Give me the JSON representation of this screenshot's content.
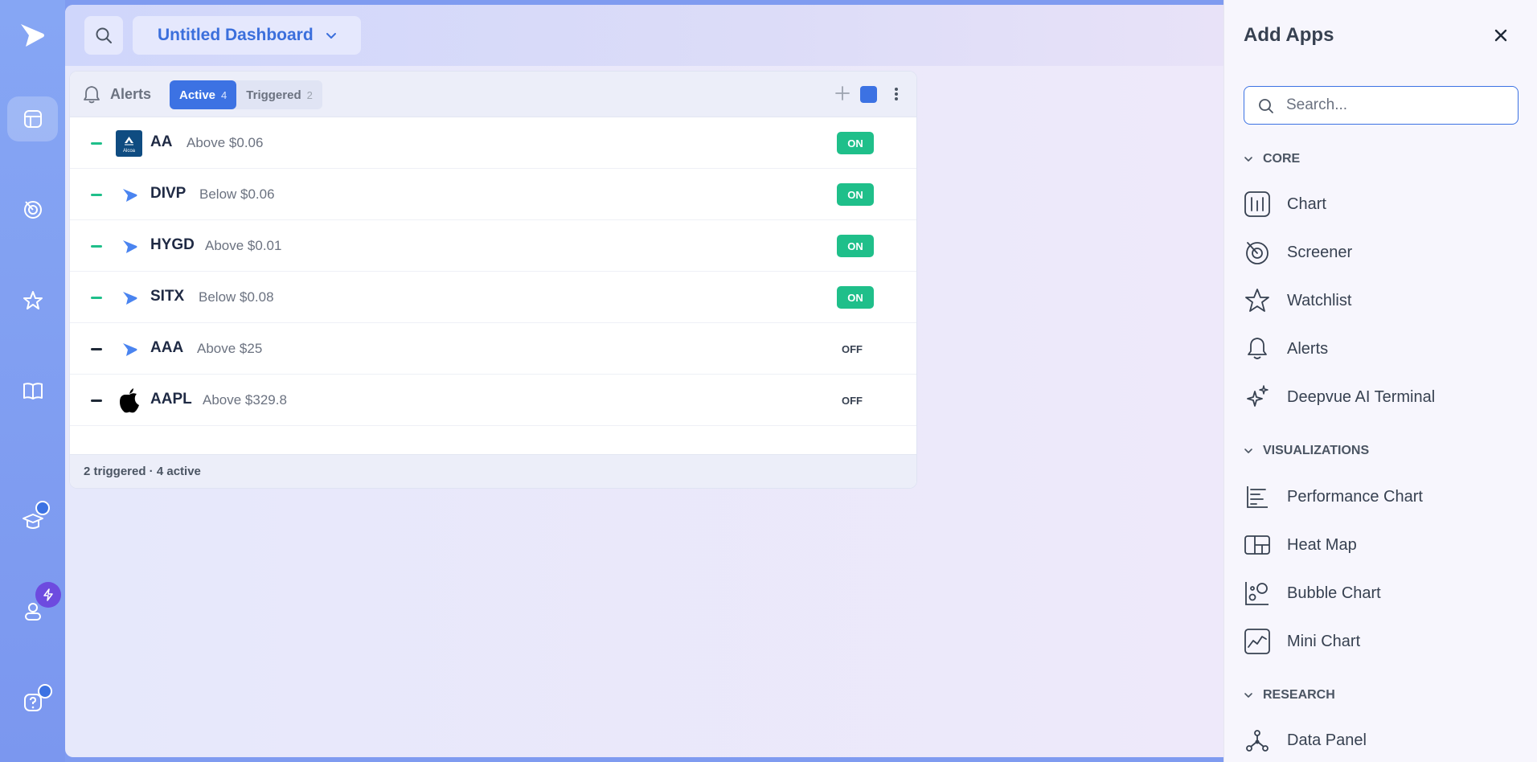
{
  "dashboard": {
    "title": "Untitled Dashboard"
  },
  "alerts": {
    "title": "Alerts",
    "tabs": [
      {
        "label": "Active",
        "count": "4"
      },
      {
        "label": "Triggered",
        "count": "2"
      }
    ],
    "rows": [
      {
        "symbol": "AA",
        "condition": "Above $0.06",
        "status": "ON",
        "logo": "alcoa-logo"
      },
      {
        "symbol": "DIVP",
        "condition": "Below $0.06",
        "status": "ON",
        "logo": "play-logo"
      },
      {
        "symbol": "HYGD",
        "condition": "Above $0.01",
        "status": "ON",
        "logo": "play-logo"
      },
      {
        "symbol": "SITX",
        "condition": "Below $0.08",
        "status": "ON",
        "logo": "play-logo"
      },
      {
        "symbol": "AAA",
        "condition": "Above $25",
        "status": "OFF",
        "logo": "play-logo"
      },
      {
        "symbol": "AAPL",
        "condition": "Above $329.8",
        "status": "OFF",
        "logo": "apple-logo"
      }
    ],
    "footer": "2 triggered · 4 active",
    "logo_text_alcoa": "Alcoa"
  },
  "panel": {
    "title": "Add Apps",
    "search_placeholder": "Search...",
    "sections": {
      "core": "CORE",
      "visualizations": "VISUALIZATIONS",
      "research": "RESEARCH"
    },
    "core_items": [
      "Chart",
      "Screener",
      "Watchlist",
      "Alerts",
      "Deepvue AI Terminal"
    ],
    "viz_items": [
      "Performance Chart",
      "Heat Map",
      "Bubble Chart",
      "Mini Chart"
    ],
    "research_items": [
      "Data Panel"
    ]
  },
  "colors": {
    "accent": "#3c72e3",
    "on": "#1fbf8a",
    "rail": "#7f9bf0"
  }
}
